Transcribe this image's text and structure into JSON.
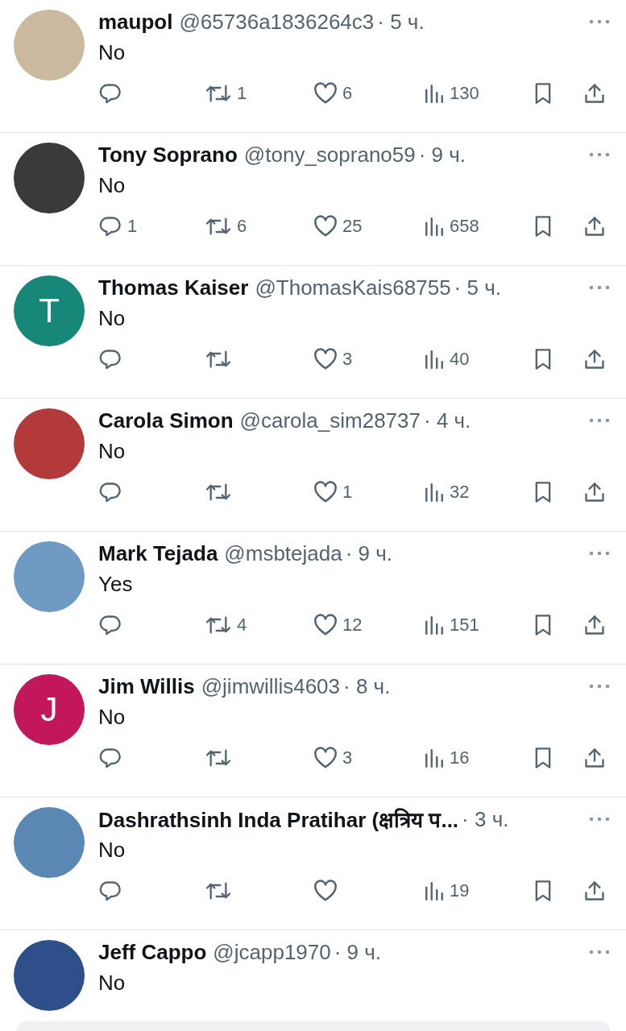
{
  "tweets": [
    {
      "avatar": {
        "kind": "photo",
        "color": "#cbb9a0"
      },
      "name": "maupol",
      "handle": "@65736a1836264c3",
      "time": "· 5 ч.",
      "text": "No",
      "retweets": "1",
      "likes": "6",
      "views": "130"
    },
    {
      "avatar": {
        "kind": "photo",
        "color": "#3a3a3a"
      },
      "name": "Tony Soprano",
      "handle": "@tony_soprano59",
      "time": "· 9 ч.",
      "text": "No",
      "replies": "1",
      "retweets": "6",
      "likes": "25",
      "views": "658"
    },
    {
      "avatar": {
        "kind": "letter",
        "color": "#17877a",
        "letter": "T"
      },
      "name": "Thomas Kaiser",
      "handle": "@ThomasKais68755",
      "time": "· 5 ч.",
      "text": "No",
      "likes": "3",
      "views": "40"
    },
    {
      "avatar": {
        "kind": "photo",
        "color": "#b23a3a"
      },
      "name": "Carola Simon",
      "handle": "@carola_sim28737",
      "time": "· 4 ч.",
      "text": "No",
      "likes": "1",
      "views": "32"
    },
    {
      "avatar": {
        "kind": "photo",
        "color": "#6f9ac4"
      },
      "name": "Mark Tejada",
      "handle": "@msbtejada",
      "time": "· 9 ч.",
      "text": "Yes",
      "retweets": "4",
      "likes": "12",
      "views": "151"
    },
    {
      "avatar": {
        "kind": "letter",
        "color": "#c2185b",
        "letter": "J"
      },
      "name": "Jim Willis",
      "handle": "@jimwillis4603",
      "time": "· 8 ч.",
      "text": "No",
      "likes": "3",
      "views": "16"
    },
    {
      "avatar": {
        "kind": "photo",
        "color": "#5b87b5"
      },
      "name": "Dashrathsinh Inda Pratihar (क्षत्रिय प...",
      "time": "· 3 ч.",
      "text": "No",
      "views": "19"
    },
    {
      "avatar": {
        "kind": "photo",
        "color": "#2f4f8a"
      },
      "name": "Jeff Cappo",
      "handle": "@jcapp1970",
      "time": "· 9 ч.",
      "text": "No"
    }
  ]
}
